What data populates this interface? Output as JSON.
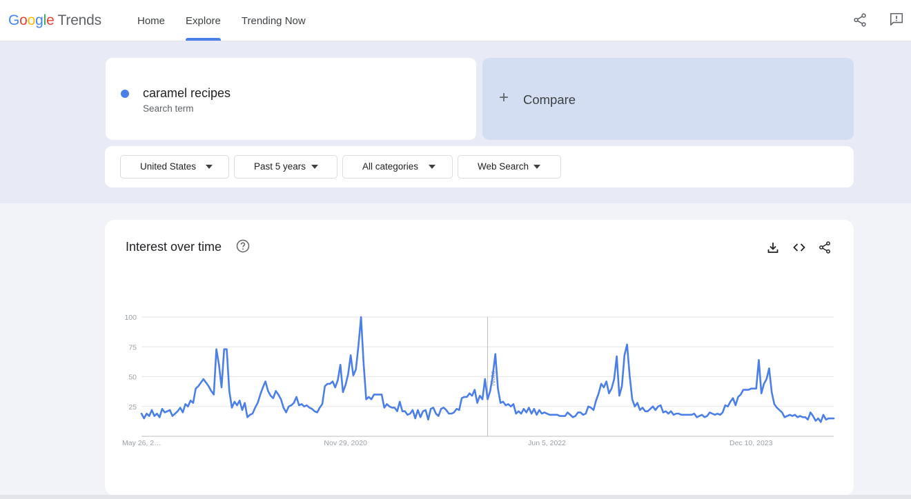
{
  "header": {
    "logo": {
      "g1": "G",
      "g2": "o",
      "g3": "o",
      "g4": "g",
      "g5": "l",
      "g6": "e",
      "trends": "Trends"
    },
    "nav": [
      "Home",
      "Explore",
      "Trending Now"
    ],
    "active_tab": "Explore"
  },
  "search_term": {
    "name": "caramel recipes",
    "type_label": "Search term",
    "color": "#4a7ee8"
  },
  "compare": {
    "plus": "+",
    "label": "Compare"
  },
  "filters": {
    "region": "United States",
    "time_range": "Past 5 years",
    "category": "All categories",
    "search_type": "Web Search"
  },
  "chart": {
    "title": "Interest over time"
  },
  "chart_data": {
    "type": "line",
    "series": [
      {
        "name": "caramel recipes",
        "color": "#4a7ee8",
        "values": [
          19,
          15,
          19,
          17,
          22,
          17,
          19,
          16,
          23,
          20,
          21,
          22,
          17,
          19,
          21,
          24,
          20,
          27,
          25,
          30,
          28,
          40,
          42,
          45,
          48,
          45,
          42,
          38,
          35,
          73,
          60,
          41,
          73,
          73,
          38,
          24,
          29,
          26,
          30,
          22,
          28,
          16,
          18,
          19,
          24,
          28,
          35,
          41,
          46,
          38,
          34,
          32,
          38,
          35,
          31,
          24,
          20,
          25,
          26,
          28,
          33,
          26,
          27,
          25,
          26,
          24,
          23,
          21,
          20,
          24,
          27,
          42,
          44,
          44,
          46,
          41,
          47,
          60,
          37,
          43,
          52,
          68,
          51,
          56,
          76,
          100,
          61,
          31,
          33,
          31,
          35,
          35,
          35,
          35,
          24,
          27,
          25,
          24,
          24,
          21,
          29,
          21,
          21,
          18,
          19,
          22,
          15,
          22,
          16,
          21,
          22,
          14,
          23,
          24,
          19,
          17,
          23,
          24,
          22,
          19,
          19,
          20,
          23,
          22,
          32,
          33,
          33,
          36,
          34,
          39,
          28,
          34,
          31,
          48,
          31,
          38,
          51,
          69,
          40,
          28,
          29,
          26,
          27,
          25,
          27,
          19,
          21,
          19,
          23,
          20,
          24,
          19,
          23,
          18,
          22,
          19,
          20,
          19,
          18,
          18,
          18,
          18,
          17,
          17,
          17,
          20,
          18,
          16,
          17,
          20,
          20,
          18,
          19,
          25,
          24,
          22,
          30,
          36,
          44,
          41,
          46,
          36,
          40,
          48,
          67,
          34,
          42,
          68,
          77,
          51,
          31,
          25,
          28,
          22,
          24,
          21,
          21,
          23,
          25,
          22,
          25,
          26,
          20,
          21,
          19,
          21,
          18,
          19,
          19,
          18,
          18,
          18,
          18,
          18,
          19,
          16,
          17,
          18,
          16,
          17,
          20,
          19,
          18,
          19,
          18,
          20,
          26,
          25,
          29,
          32,
          26,
          33,
          35,
          39,
          39,
          39,
          40,
          40,
          40,
          64,
          36,
          44,
          48,
          57,
          37,
          27,
          24,
          22,
          20,
          16,
          17,
          18,
          17,
          18,
          16,
          17,
          16,
          16,
          14,
          20,
          17,
          13,
          15,
          12,
          18,
          14,
          15,
          15,
          15
        ]
      }
    ],
    "x_tick_labels": [
      "May 26, 2…",
      "Nov 29, 2020",
      "Jun 5, 2022",
      "Dec 10, 2023"
    ],
    "x_tick_indices": [
      0,
      79,
      157,
      236
    ],
    "y_ticks": [
      25,
      50,
      75,
      100
    ],
    "ylim": [
      0,
      100
    ],
    "note_index": 134,
    "note_label": "Note",
    "grid": true
  }
}
